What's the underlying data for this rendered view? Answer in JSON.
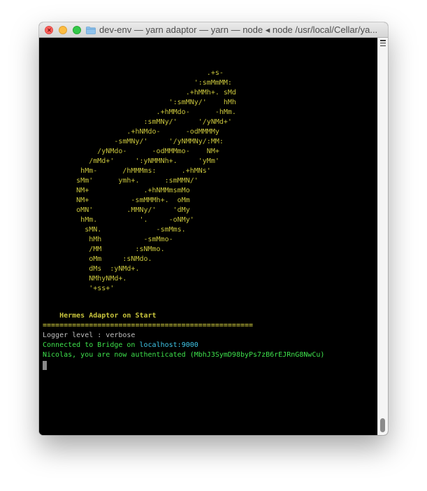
{
  "window": {
    "title": "dev-env — yarn adaptor — yarn — node ◂ node /usr/local/Cellar/ya...",
    "buttons": [
      "close",
      "minimize",
      "zoom"
    ],
    "title_icon": "folder-icon"
  },
  "terminal": {
    "ascii_art": "                                       .+s-\n                                    ':smMmMM:\n                                  .+hMMh+. sMd\n                              ':smMNy/'    hMh\n                           .+hMMdo-      -hMm.\n                        :smMNy/'     '/yNMd+'\n                    .+hNMdo-      -odMMMMy\n                 -smMNy/'     '/yNMMNy/:MM:\n             /yNMdo-      -odMMMmo-    NM+\n           /mMd+'     ':yNMMNh+.     'yMm'\n         hMm-      /hMMMms:      .+hMNs'\n        sMm'      ymh+.      :smMMN/'\n        NM+             .+hNMMmsmMo\n        NM+          -smMMMh+.  oMm\n        oMN'        .MMNy/'    'dMy\n         hMm.          '.     -oNMy'\n          sMN.             -smMms.\n           hMh          -smMmo-\n           /MM        :sNMmo.\n           oMm     :sNMdo.\n           dMs  :yNMd+.\n           NMhyNMd+.\n           '+ss+'",
    "banner": "    Hermes Adaptor on Start",
    "rule": "==================================================",
    "logger": "Logger level : verbose",
    "connected_prefix": "Connected to Bridge on ",
    "connected_host": "localhost:9000",
    "auth": "Nicolas, you are now authenticated (MbhJ3SymD98byPs7zB6rEJRnG8NwCu)"
  },
  "colors": {
    "art": "#c8c43c",
    "logger": "#bfbfbf",
    "success": "#3ee24c",
    "host": "#3fc6e8",
    "background": "#000000"
  }
}
